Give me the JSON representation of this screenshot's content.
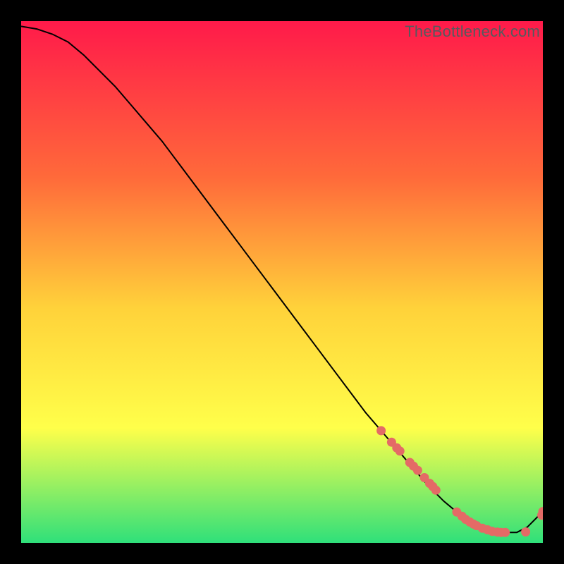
{
  "watermark": "TheBottleneck.com",
  "colors": {
    "bg": "#000000",
    "grad_top": "#ff1a4a",
    "grad_mid1": "#ff6a3a",
    "grad_mid2": "#ffd23a",
    "grad_mid3": "#ffff4a",
    "grad_bot": "#2fe07a",
    "curve": "#000000",
    "marker": "#e46a66"
  },
  "chart_data": {
    "type": "line",
    "title": "",
    "xlabel": "",
    "ylabel": "",
    "xlim": [
      0,
      100
    ],
    "ylim": [
      0,
      100
    ],
    "series": [
      {
        "name": "curve",
        "x": [
          0,
          3,
          6,
          9,
          12,
          15,
          18,
          21,
          24,
          27,
          30,
          33,
          36,
          39,
          42,
          45,
          48,
          51,
          54,
          57,
          60,
          63,
          66,
          69,
          72,
          75,
          78,
          81,
          84,
          87,
          89,
          91,
          93,
          95,
          97,
          100
        ],
        "y": [
          99,
          98.5,
          97.5,
          96,
          93.5,
          90.5,
          87.5,
          84,
          80.5,
          77,
          73,
          69,
          65,
          61,
          57,
          53,
          49,
          45,
          41,
          37,
          33,
          29,
          25,
          21.5,
          18,
          14.5,
          11,
          8,
          5.5,
          3.5,
          2.5,
          2,
          2,
          2,
          3,
          6
        ]
      }
    ],
    "markers": {
      "name": "datapoints",
      "x": [
        69,
        71,
        72,
        72.6,
        74.5,
        75.2,
        76,
        77.3,
        78.3,
        78.9,
        79.5,
        83.5,
        84.5,
        85.2,
        86,
        86.7,
        87.3,
        88.4,
        89.4,
        90.3,
        91.3,
        92,
        92.8,
        96.7,
        99.8,
        100
      ],
      "y": [
        21.5,
        19.3,
        18.2,
        17.6,
        15.4,
        14.7,
        13.9,
        12.5,
        11.4,
        10.8,
        10.1,
        5.9,
        5.1,
        4.5,
        4,
        3.6,
        3.3,
        2.8,
        2.5,
        2.2,
        2.05,
        2,
        2,
        2.1,
        5.3,
        6
      ]
    }
  }
}
